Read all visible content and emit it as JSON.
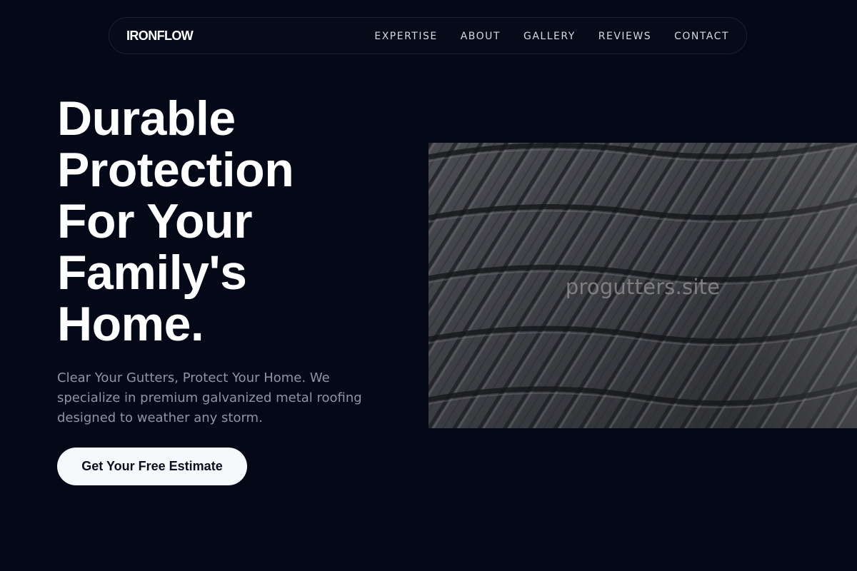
{
  "brand": {
    "name": "IRONFLOW"
  },
  "nav": {
    "links": [
      {
        "label": "EXPERTISE"
      },
      {
        "label": "ABOUT"
      },
      {
        "label": "GALLERY"
      },
      {
        "label": "REVIEWS"
      },
      {
        "label": "CONTACT"
      }
    ]
  },
  "hero": {
    "title_lines": [
      "Durable",
      "Protection",
      "For Your",
      "Family's",
      "Home."
    ],
    "subtitle": "Clear Your Gutters, Protect Your Home. We specialize in premium galvanized metal roofing designed to weather any storm.",
    "cta_label": "Get Your Free Estimate"
  },
  "image": {
    "subject": "dark-metal-roof-tiles",
    "watermark": "progutters.site"
  },
  "colors": {
    "background": "#040817",
    "nav_border": "#1c2233",
    "text_primary": "#ffffff",
    "text_muted": "#8d95a8",
    "cta_background": "#f7f8fb",
    "cta_text": "#0a0e1c"
  }
}
